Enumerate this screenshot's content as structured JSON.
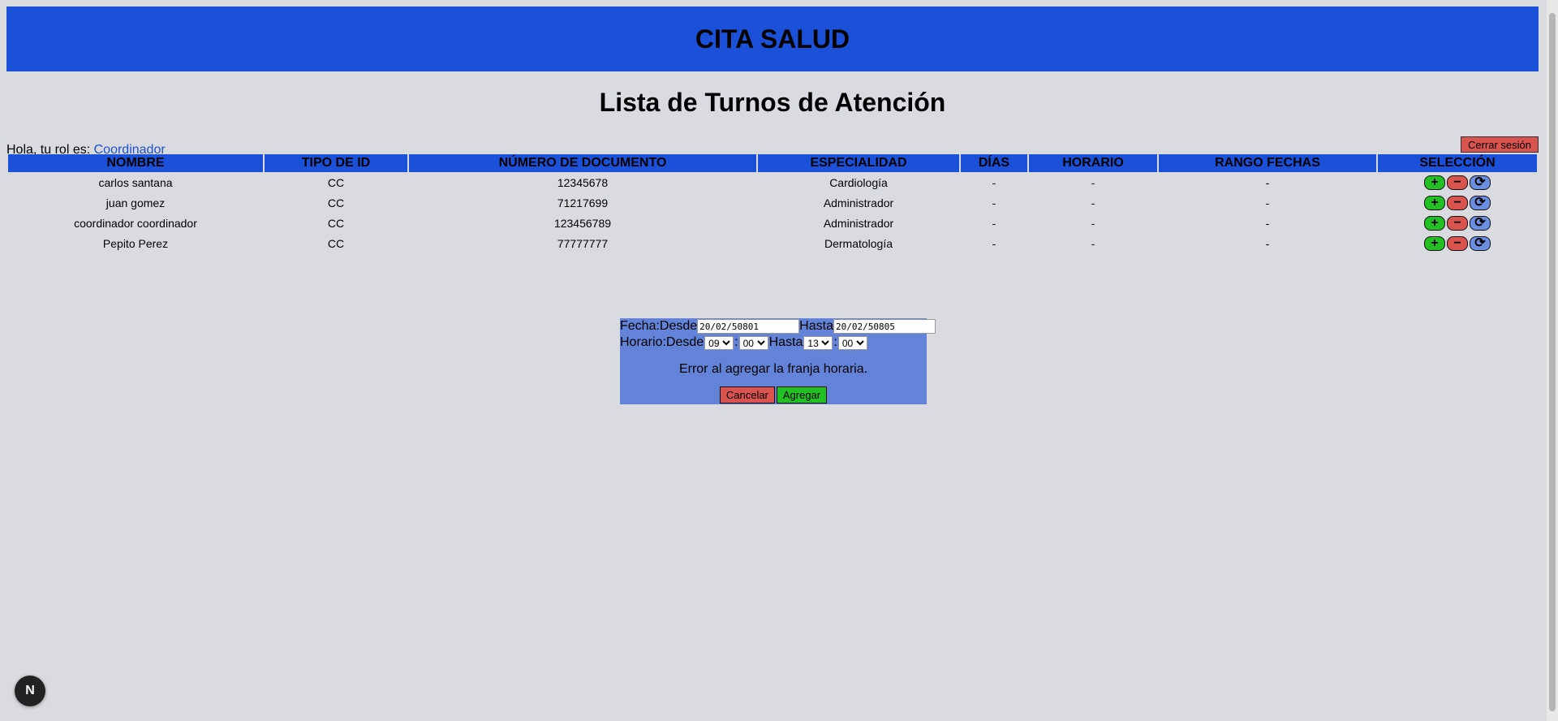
{
  "header": {
    "title": "CITA SALUD"
  },
  "page_title": "Lista de Turnos de Atención",
  "greeting": {
    "text": "Hola, tu rol es:",
    "role": "Coordinador"
  },
  "logout_label": "Cerrar sesión",
  "table": {
    "columns": [
      "NOMBRE",
      "TIPO DE ID",
      "NÚMERO DE DOCUMENTO",
      "ESPECIALIDAD",
      "DÍAS",
      "HORARIO",
      "RANGO FECHAS",
      "SELECCIÓN"
    ],
    "rows": [
      {
        "nombre": "carlos santana",
        "tipo_id": "CC",
        "documento": "12345678",
        "especialidad": "Cardiología",
        "dias": "-",
        "horario": "-",
        "rango": "-"
      },
      {
        "nombre": "juan gomez",
        "tipo_id": "CC",
        "documento": "71217699",
        "especialidad": "Administrador",
        "dias": "-",
        "horario": "-",
        "rango": "-"
      },
      {
        "nombre": "coordinador coordinador",
        "tipo_id": "CC",
        "documento": "123456789",
        "especialidad": "Administrador",
        "dias": "-",
        "horario": "-",
        "rango": "-"
      },
      {
        "nombre": "Pepito Perez",
        "tipo_id": "CC",
        "documento": "77777777",
        "especialidad": "Dermatología",
        "dias": "-",
        "horario": "-",
        "rango": "-"
      }
    ],
    "actions": {
      "add": "+",
      "remove": "−",
      "refresh": "⟳"
    }
  },
  "modal": {
    "fecha_label": "Fecha:",
    "desde_label": "Desde",
    "hasta_label": "Hasta",
    "fecha_desde": "20/02/50801",
    "fecha_hasta": "20/02/50805",
    "horario_label": "Horario:",
    "sep": ":",
    "hora_desde": "09",
    "min_desde": "00",
    "hora_hasta": "13",
    "min_hasta": "00",
    "error": "Error al agregar la franja horaria.",
    "cancel_label": "Cancelar",
    "add_label": "Agregar"
  },
  "badge": "N",
  "colors": {
    "primary": "#1b50d8",
    "background": "#dadbe0",
    "danger": "#d9534f",
    "success": "#22c022",
    "modal": "#6283d8"
  }
}
